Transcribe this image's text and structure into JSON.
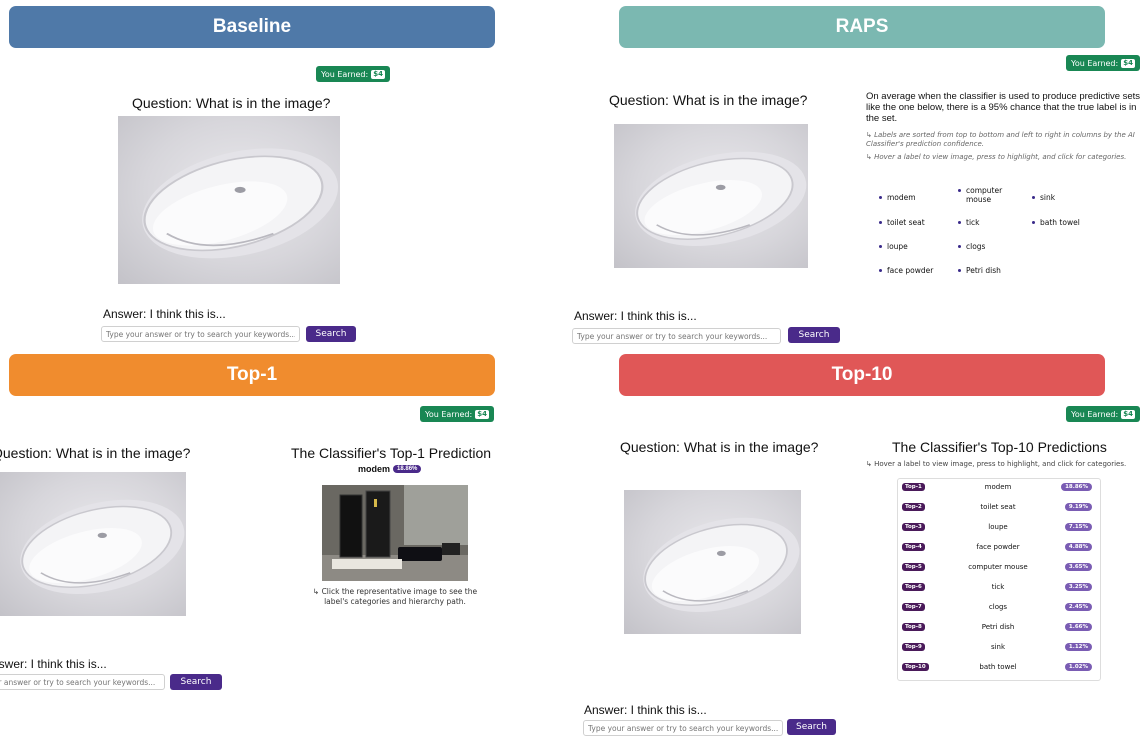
{
  "common": {
    "question": "Question: What is in the image?",
    "answer_title": "Answer: I think this is...",
    "input_placeholder": "Type your answer or try to search your keywords...",
    "search_label": "Search",
    "earned_label": "You Earned:",
    "earned_amount": "$4",
    "hover_hint": "Hover a label to view image, press to highlight, and click for categories."
  },
  "baseline": {
    "title": "Baseline",
    "color": "#4f79a8"
  },
  "raps": {
    "title": "RAPS",
    "color": "#7bb8b1",
    "description": "On average when the classifier is used to produce predictive sets like the one below, there is a 95% chance that the true label is in the set.",
    "hint1": "Labels are sorted from top to bottom and left to right in columns by the AI Classifier's prediction confidence.",
    "hint2": "Hover a label to view image, press to highlight, and click for categories.",
    "labels": [
      "modem",
      "toilet seat",
      "loupe",
      "face powder",
      "computer mouse",
      "tick",
      "clogs",
      "Petri dish",
      "sink",
      "bath towel"
    ]
  },
  "top1": {
    "title": "Top-1",
    "color": "#f08c2e",
    "prediction_title": "The Classifier's Top-1 Prediction",
    "label": "modem",
    "pct": "18.86%",
    "caption": "Click the representative image to see the label's categories and hierarchy path."
  },
  "top10": {
    "title": "Top-10",
    "color": "#e05757",
    "prediction_title": "The Classifier's Top-10 Predictions",
    "rows": [
      {
        "rank": "Top-1",
        "label": "modem",
        "pct": "18.86%"
      },
      {
        "rank": "Top-2",
        "label": "toilet seat",
        "pct": "9.19%"
      },
      {
        "rank": "Top-3",
        "label": "loupe",
        "pct": "7.15%"
      },
      {
        "rank": "Top-4",
        "label": "face powder",
        "pct": "4.88%"
      },
      {
        "rank": "Top-5",
        "label": "computer mouse",
        "pct": "3.65%"
      },
      {
        "rank": "Top-6",
        "label": "tick",
        "pct": "3.25%"
      },
      {
        "rank": "Top-7",
        "label": "clogs",
        "pct": "2.45%"
      },
      {
        "rank": "Top-8",
        "label": "Petri dish",
        "pct": "1.66%"
      },
      {
        "rank": "Top-9",
        "label": "sink",
        "pct": "1.12%"
      },
      {
        "rank": "Top-10",
        "label": "bath towel",
        "pct": "1.02%"
      }
    ]
  }
}
